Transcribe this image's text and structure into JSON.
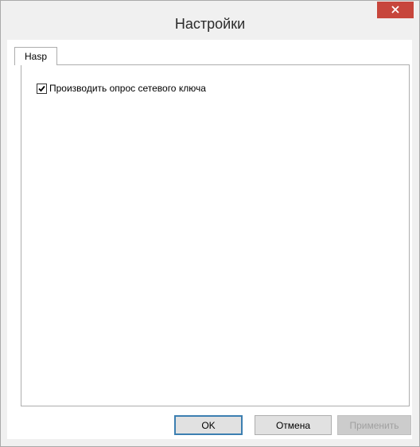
{
  "window": {
    "title": "Настройки"
  },
  "tabs": [
    {
      "label": "Hasp",
      "active": true
    }
  ],
  "hasp_panel": {
    "poll_network_key": {
      "label": "Производить опрос сетевого ключа",
      "checked": true
    }
  },
  "buttons": {
    "ok": "OK",
    "cancel": "Отмена",
    "apply": "Применить"
  },
  "colors": {
    "close_button": "#c7463c",
    "default_button_border": "#3c7fb1"
  },
  "icons": {
    "close": "close-icon",
    "check": "checkmark-icon"
  }
}
